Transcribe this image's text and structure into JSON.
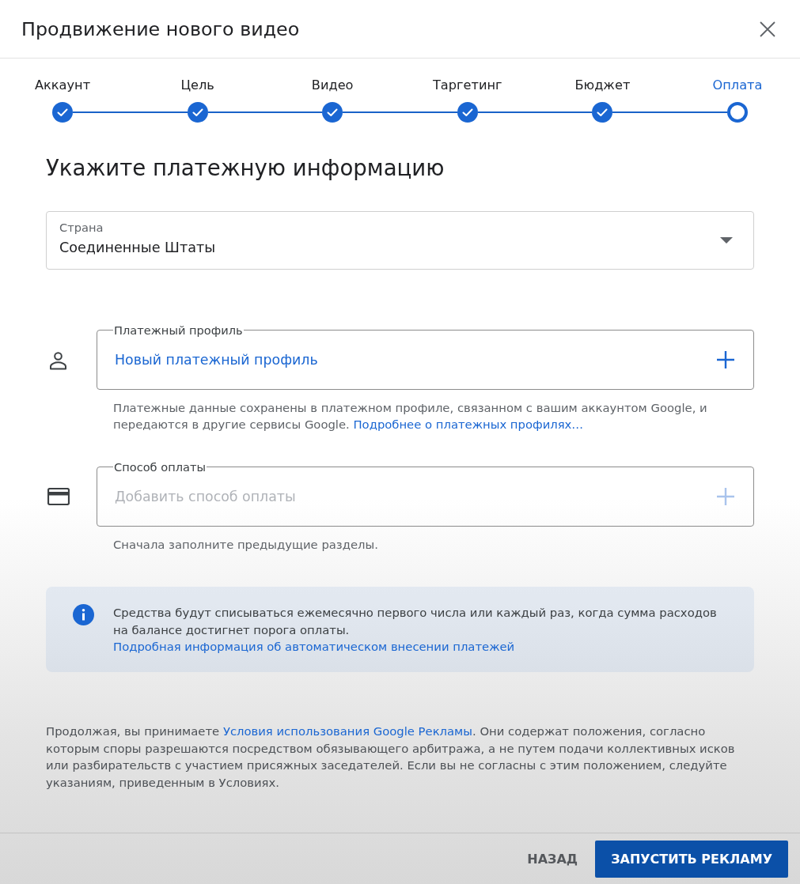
{
  "dialog": {
    "title": "Продвижение нового видео"
  },
  "stepper": {
    "steps": [
      {
        "label": "Аккаунт",
        "completed": true,
        "selected": false
      },
      {
        "label": "Цель",
        "completed": true,
        "selected": false
      },
      {
        "label": "Видео",
        "completed": true,
        "selected": false
      },
      {
        "label": "Таргетинг",
        "completed": true,
        "selected": false
      },
      {
        "label": "Бюджет",
        "completed": true,
        "selected": false
      },
      {
        "label": "Оплата",
        "completed": false,
        "selected": true
      }
    ]
  },
  "heading": "Укажите платежную информацию",
  "country": {
    "label": "Страна",
    "value": "Соединенные Штаты"
  },
  "payment_profile": {
    "label": "Платежный профиль",
    "action": "Новый платежный профиль",
    "disabled": false,
    "help": [
      {
        "kind": "text",
        "text": "Платежные данные сохранены в платежном профиле, связанном с вашим аккаунтом Google, и передаются в другие сервисы Google. "
      },
      {
        "kind": "link",
        "text": "Подробнее о платежных профилях…"
      }
    ]
  },
  "payment_method": {
    "label": "Способ оплаты",
    "action": "Добавить способ оплаты",
    "disabled": true,
    "help": [
      {
        "kind": "text",
        "text": "Сначала заполните предыдущие разделы."
      }
    ]
  },
  "info_banner": {
    "parts": [
      {
        "kind": "text",
        "text": "Средства будут списываться ежемесячно первого числа или каждый раз, когда сумма расходов на балансе достигнет порога оплаты. "
      },
      {
        "kind": "link",
        "text": "Подробная информация об автоматическом внесении платежей"
      }
    ]
  },
  "terms": {
    "parts": [
      {
        "kind": "text",
        "text": "Продолжая, вы принимаете "
      },
      {
        "kind": "link",
        "text": "Условия использования Google Рекламы"
      },
      {
        "kind": "text",
        "text": ". Они содержат положения, согласно которым споры разрешаются посредством обязывающего арбитража, а не путем подачи коллективных исков или разбирательств с участием присяжных заседателей. Если вы не согласны с этим положением, следуйте указаниям, приведенным в Условиях."
      }
    ]
  },
  "buttons": [
    {
      "label": "НАЗАД",
      "kind": "text"
    },
    {
      "label": "ЗАПУСТИТЬ РЕКЛАМУ",
      "kind": "primary"
    }
  ]
}
